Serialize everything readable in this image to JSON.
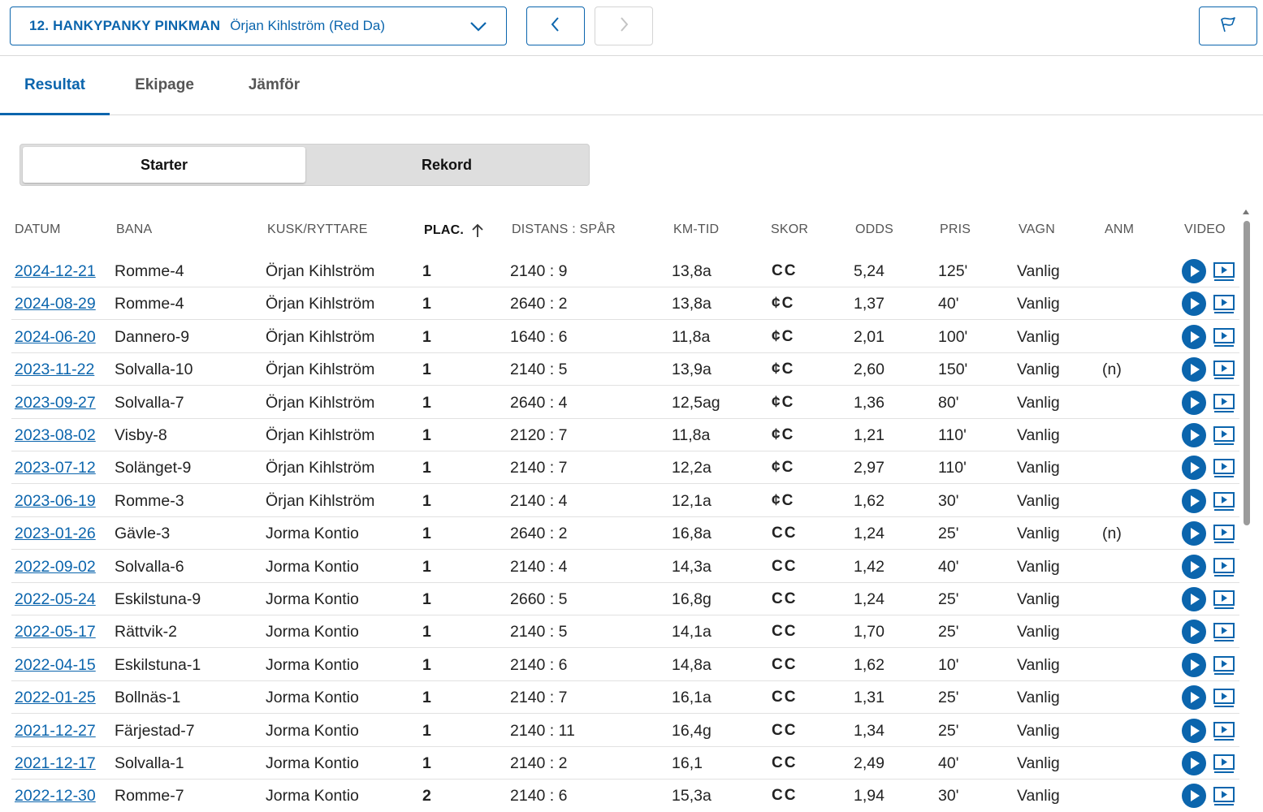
{
  "header": {
    "horse_name": "12. HANKYPANKY PINKMAN",
    "driver": "Örjan Kihlström (Red Da)",
    "icons": {
      "dropdown": "chevron-down-icon",
      "prev": "chevron-left-icon",
      "next": "chevron-right-icon",
      "report": "flag-icon"
    }
  },
  "tabs": [
    {
      "label": "Resultat",
      "active": true
    },
    {
      "label": "Ekipage",
      "active": false
    },
    {
      "label": "Jämför",
      "active": false
    }
  ],
  "segment": {
    "starter": "Starter",
    "rekord": "Rekord",
    "selected": "Starter"
  },
  "table": {
    "headers": {
      "datum": "DATUM",
      "bana": "BANA",
      "kusk": "KUSK/RYTTARE",
      "plac": "PLAC.",
      "distans": "DISTANS : SPÅR",
      "kmtid": "KM-TID",
      "skor": "SKOR",
      "odds": "ODDS",
      "pris": "PRIS",
      "vagn": "VAGN",
      "anm": "ANM",
      "video": "VIDEO"
    },
    "sort": {
      "column": "PLAC.",
      "direction": "ascending"
    },
    "rows": [
      {
        "datum": "2024-12-21",
        "bana": "Romme-4",
        "kusk": "Örjan Kihlström",
        "plac": "1",
        "distans": "2140 : 9",
        "kmtid": "13,8a",
        "skor": "CC",
        "odds": "5,24",
        "pris": "125'",
        "vagn": "Vanlig",
        "anm": ""
      },
      {
        "datum": "2024-08-29",
        "bana": "Romme-4",
        "kusk": "Örjan Kihlström",
        "plac": "1",
        "distans": "2640 : 2",
        "kmtid": "13,8a",
        "skor": "¢C",
        "odds": "1,37",
        "pris": "40'",
        "vagn": "Vanlig",
        "anm": ""
      },
      {
        "datum": "2024-06-20",
        "bana": "Dannero-9",
        "kusk": "Örjan Kihlström",
        "plac": "1",
        "distans": "1640 : 6",
        "kmtid": "11,8a",
        "skor": "¢C",
        "odds": "2,01",
        "pris": "100'",
        "vagn": "Vanlig",
        "anm": ""
      },
      {
        "datum": "2023-11-22",
        "bana": "Solvalla-10",
        "kusk": "Örjan Kihlström",
        "plac": "1",
        "distans": "2140 : 5",
        "kmtid": "13,9a",
        "skor": "¢C",
        "odds": "2,60",
        "pris": "150'",
        "vagn": "Vanlig",
        "anm": "(n)"
      },
      {
        "datum": "2023-09-27",
        "bana": "Solvalla-7",
        "kusk": "Örjan Kihlström",
        "plac": "1",
        "distans": "2640 : 4",
        "kmtid": "12,5ag",
        "skor": "¢C",
        "odds": "1,36",
        "pris": "80'",
        "vagn": "Vanlig",
        "anm": ""
      },
      {
        "datum": "2023-08-02",
        "bana": "Visby-8",
        "kusk": "Örjan Kihlström",
        "plac": "1",
        "distans": "2120 : 7",
        "kmtid": "11,8a",
        "skor": "¢C",
        "odds": "1,21",
        "pris": "110'",
        "vagn": "Vanlig",
        "anm": ""
      },
      {
        "datum": "2023-07-12",
        "bana": "Solänget-9",
        "kusk": "Örjan Kihlström",
        "plac": "1",
        "distans": "2140 : 7",
        "kmtid": "12,2a",
        "skor": "¢C",
        "odds": "2,97",
        "pris": "110'",
        "vagn": "Vanlig",
        "anm": ""
      },
      {
        "datum": "2023-06-19",
        "bana": "Romme-3",
        "kusk": "Örjan Kihlström",
        "plac": "1",
        "distans": "2140 : 4",
        "kmtid": "12,1a",
        "skor": "¢C",
        "odds": "1,62",
        "pris": "30'",
        "vagn": "Vanlig",
        "anm": ""
      },
      {
        "datum": "2023-01-26",
        "bana": "Gävle-3",
        "kusk": "Jorma Kontio",
        "plac": "1",
        "distans": "2640 : 2",
        "kmtid": "16,8a",
        "skor": "CC",
        "odds": "1,24",
        "pris": "25'",
        "vagn": "Vanlig",
        "anm": "(n)"
      },
      {
        "datum": "2022-09-02",
        "bana": "Solvalla-6",
        "kusk": "Jorma Kontio",
        "plac": "1",
        "distans": "2140 : 4",
        "kmtid": "14,3a",
        "skor": "CC",
        "odds": "1,42",
        "pris": "40'",
        "vagn": "Vanlig",
        "anm": ""
      },
      {
        "datum": "2022-05-24",
        "bana": "Eskilstuna-9",
        "kusk": "Jorma Kontio",
        "plac": "1",
        "distans": "2660 : 5",
        "kmtid": "16,8g",
        "skor": "CC",
        "odds": "1,24",
        "pris": "25'",
        "vagn": "Vanlig",
        "anm": ""
      },
      {
        "datum": "2022-05-17",
        "bana": "Rättvik-2",
        "kusk": "Jorma Kontio",
        "plac": "1",
        "distans": "2140 : 5",
        "kmtid": "14,1a",
        "skor": "CC",
        "odds": "1,70",
        "pris": "25'",
        "vagn": "Vanlig",
        "anm": ""
      },
      {
        "datum": "2022-04-15",
        "bana": "Eskilstuna-1",
        "kusk": "Jorma Kontio",
        "plac": "1",
        "distans": "2140 : 6",
        "kmtid": "14,8a",
        "skor": "CC",
        "odds": "1,62",
        "pris": "10'",
        "vagn": "Vanlig",
        "anm": ""
      },
      {
        "datum": "2022-01-25",
        "bana": "Bollnäs-1",
        "kusk": "Jorma Kontio",
        "plac": "1",
        "distans": "2140 : 7",
        "kmtid": "16,1a",
        "skor": "CC",
        "odds": "1,31",
        "pris": "25'",
        "vagn": "Vanlig",
        "anm": ""
      },
      {
        "datum": "2021-12-27",
        "bana": "Färjestad-7",
        "kusk": "Jorma Kontio",
        "plac": "1",
        "distans": "2140 : 11",
        "kmtid": "16,4g",
        "skor": "CC",
        "odds": "1,34",
        "pris": "25'",
        "vagn": "Vanlig",
        "anm": ""
      },
      {
        "datum": "2021-12-17",
        "bana": "Solvalla-1",
        "kusk": "Jorma Kontio",
        "plac": "1",
        "distans": "2140 : 2",
        "kmtid": "16,1",
        "skor": "CC",
        "odds": "2,49",
        "pris": "40'",
        "vagn": "Vanlig",
        "anm": ""
      },
      {
        "datum": "2022-12-30",
        "bana": "Romme-7",
        "kusk": "Jorma Kontio",
        "plac": "2",
        "distans": "2140 : 6",
        "kmtid": "15,3a",
        "skor": "CC",
        "odds": "1,94",
        "pris": "30'",
        "vagn": "Vanlig",
        "anm": ""
      }
    ],
    "row_icons": {
      "play": "play-circle-icon",
      "video": "video-replay-icon"
    }
  },
  "colors": {
    "accent": "#0b65ad",
    "divider": "#e1e1e1",
    "segment_bg": "#dedede"
  }
}
